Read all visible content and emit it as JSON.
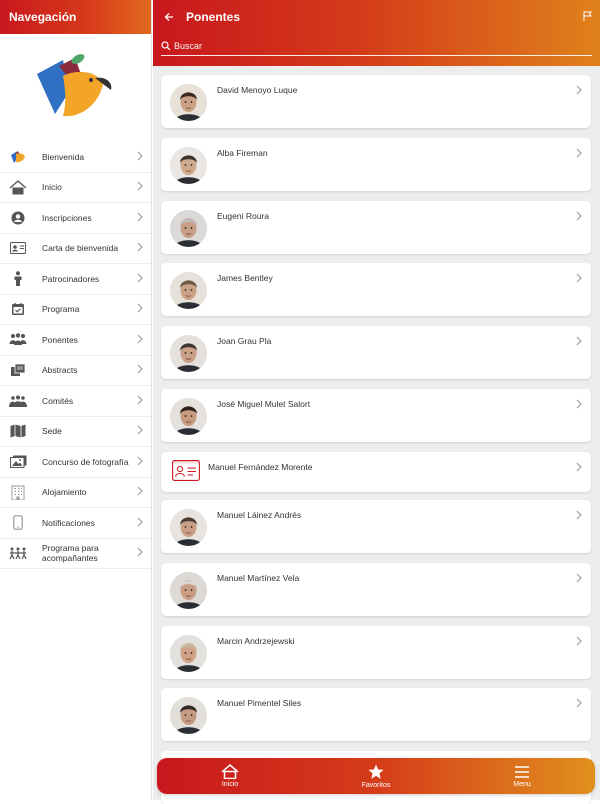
{
  "nav": {
    "title": "Navegación",
    "items": [
      {
        "label": "Bienvenida",
        "icon": "bird-icon"
      },
      {
        "label": "Inicio",
        "icon": "home-icon"
      },
      {
        "label": "Inscripciones",
        "icon": "user-circle-icon"
      },
      {
        "label": "Carta de bienvenida",
        "icon": "id-card-icon"
      },
      {
        "label": "Patrocinadores",
        "icon": "person-icon"
      },
      {
        "label": "Programa",
        "icon": "calendar-icon"
      },
      {
        "label": "Ponentes",
        "icon": "group-icon"
      },
      {
        "label": "Abstracts",
        "icon": "documents-icon"
      },
      {
        "label": "Comités",
        "icon": "committee-icon"
      },
      {
        "label": "Sede",
        "icon": "map-icon"
      },
      {
        "label": "Concurso de fotografía",
        "icon": "photo-icon"
      },
      {
        "label": "Alojamiento",
        "icon": "building-icon"
      },
      {
        "label": "Notificaciones",
        "icon": "phone-icon"
      },
      {
        "label": "Programa para acompañantes",
        "icon": "companions-icon"
      }
    ]
  },
  "header": {
    "title": "Ponentes",
    "search_placeholder": "Buscar"
  },
  "speakers": [
    {
      "name": "David Menoyo Luque",
      "avatar": true
    },
    {
      "name": "Alba Fireman",
      "avatar": true
    },
    {
      "name": "Eugeni Roura",
      "avatar": true
    },
    {
      "name": "James Bentley",
      "avatar": true
    },
    {
      "name": "Joan Grau Pla",
      "avatar": true
    },
    {
      "name": "José Miguel Mulet Salort",
      "avatar": true
    },
    {
      "name": "Manuel Fernández Morente",
      "avatar": false
    },
    {
      "name": "Manuel Láinez Andrés",
      "avatar": true
    },
    {
      "name": "Manuel Martínez Vela",
      "avatar": true
    },
    {
      "name": "Marcin Andrzejewski",
      "avatar": true
    },
    {
      "name": "Manuel Pimentel Siles",
      "avatar": true
    }
  ],
  "tabs": [
    {
      "label": "Inicio",
      "icon": "home-icon"
    },
    {
      "label": "Favoritos",
      "icon": "star-icon"
    },
    {
      "label": "Menu",
      "icon": "menu-icon"
    }
  ],
  "colors": {
    "primary": "#c8171d",
    "accent": "#e0901d",
    "background": "#ededed"
  }
}
